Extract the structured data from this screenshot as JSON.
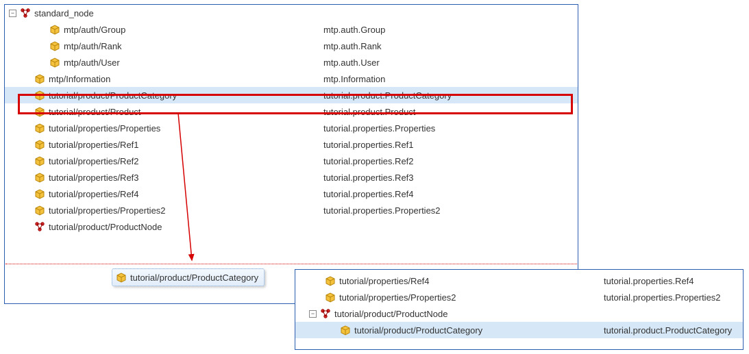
{
  "panelA": {
    "root": {
      "label": "standard_node",
      "expanded": true
    },
    "rows": [
      {
        "indent": 2,
        "icon": "box",
        "path": "mtp/auth/Group",
        "type": "mtp.auth.Group"
      },
      {
        "indent": 2,
        "icon": "box",
        "path": "mtp/auth/Rank",
        "type": "mtp.auth.Rank"
      },
      {
        "indent": 2,
        "icon": "box",
        "path": "mtp/auth/User",
        "type": "mtp.auth.User"
      },
      {
        "indent": 1,
        "icon": "box",
        "path": "mtp/Information",
        "type": "mtp.Information"
      },
      {
        "indent": 1,
        "icon": "box",
        "path": "tutorial/product/ProductCategory",
        "type": "tutorial.product.ProductCategory",
        "selected": true,
        "highlighted": true
      },
      {
        "indent": 1,
        "icon": "box",
        "path": "tutorial/product/Product",
        "type": "tutorial.product.Product"
      },
      {
        "indent": 1,
        "icon": "box",
        "path": "tutorial/properties/Properties",
        "type": "tutorial.properties.Properties"
      },
      {
        "indent": 1,
        "icon": "box",
        "path": "tutorial/properties/Ref1",
        "type": "tutorial.properties.Ref1"
      },
      {
        "indent": 1,
        "icon": "box",
        "path": "tutorial/properties/Ref2",
        "type": "tutorial.properties.Ref2"
      },
      {
        "indent": 1,
        "icon": "box",
        "path": "tutorial/properties/Ref3",
        "type": "tutorial.properties.Ref3"
      },
      {
        "indent": 1,
        "icon": "box",
        "path": "tutorial/properties/Ref4",
        "type": "tutorial.properties.Ref4"
      },
      {
        "indent": 1,
        "icon": "box",
        "path": "tutorial/properties/Properties2",
        "type": "tutorial.properties.Properties2"
      },
      {
        "indent": 1,
        "icon": "node",
        "path": "tutorial/product/ProductNode",
        "type": ""
      }
    ]
  },
  "drag": {
    "label": "tutorial/product/ProductCategory"
  },
  "panelB": {
    "rows": [
      {
        "indent": 1,
        "icon": "box",
        "path": "tutorial/properties/Ref4",
        "type": "tutorial.properties.Ref4"
      },
      {
        "indent": 1,
        "icon": "box",
        "path": "tutorial/properties/Properties2",
        "type": "tutorial.properties.Properties2"
      },
      {
        "indent": 0,
        "icon": "node",
        "expander": "minus",
        "path": "tutorial/product/ProductNode",
        "type": ""
      },
      {
        "indent": 2,
        "icon": "box",
        "path": "tutorial/product/ProductCategory",
        "type": "tutorial.product.ProductCategory",
        "selected": true
      }
    ]
  }
}
